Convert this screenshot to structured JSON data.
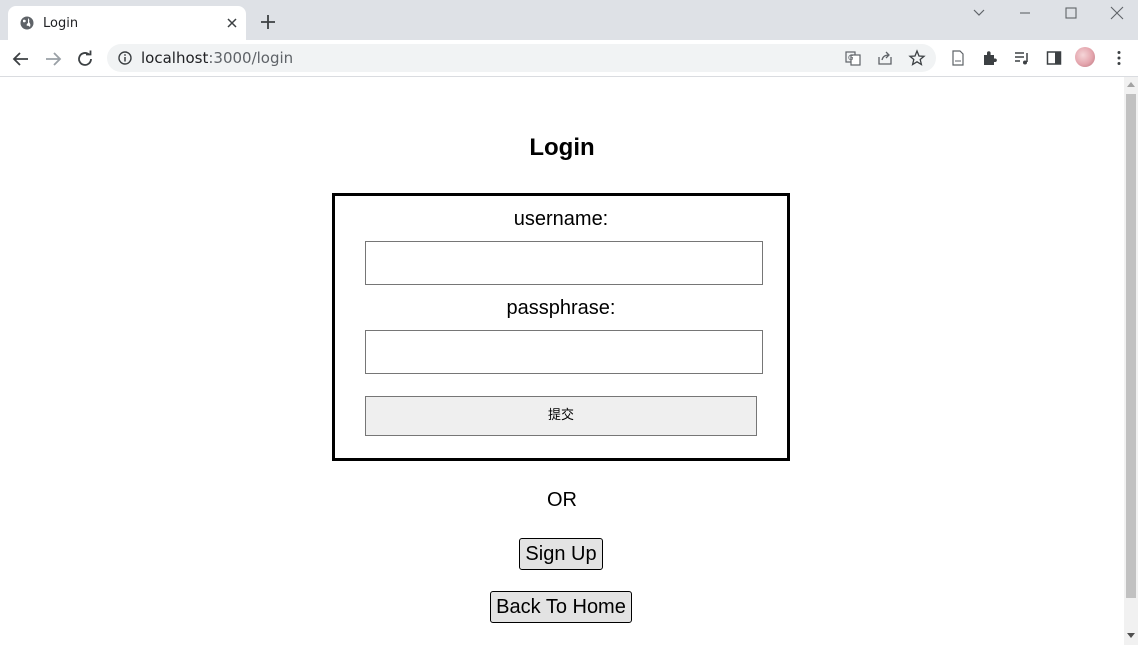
{
  "browser": {
    "tab_title": "Login",
    "url_host": "localhost",
    "url_path": ":3000/login"
  },
  "page": {
    "heading": "Login",
    "username_label": "username:",
    "passphrase_label": "passphrase:",
    "username_value": "",
    "passphrase_value": "",
    "submit_label": "提交",
    "or_text": "OR",
    "signup_label": "Sign Up",
    "home_label": "Back To Home"
  }
}
